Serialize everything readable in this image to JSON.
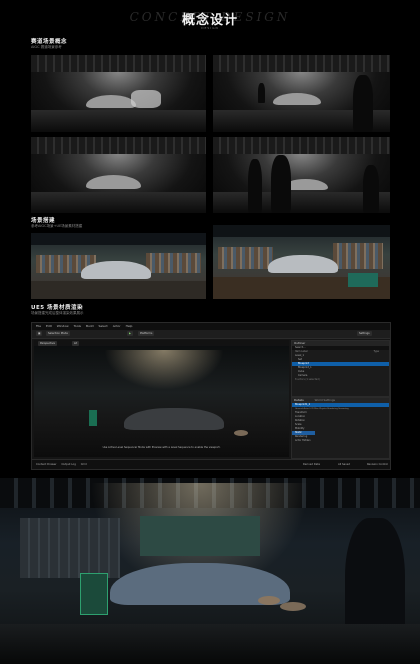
{
  "header": {
    "ghost_text": "CONCEPT DESIGN",
    "title": "概念设计",
    "subtitle": "DESIGN"
  },
  "section1": {
    "heading": "赛道场景概念",
    "caption": "AIGC 赛道场景参考"
  },
  "section2": {
    "heading": "场景搭建",
    "caption": "参考AIGC场景+UE场景素材搭建"
  },
  "section3": {
    "heading": "UE5 场景材质渲染",
    "caption": "场景搭建完成后整体渲染效果展示"
  },
  "editor": {
    "menu": [
      "File",
      "Edit",
      "Window",
      "Tools",
      "Build",
      "Select",
      "Actor",
      "Help"
    ],
    "toolbar": {
      "mode": "Selection Mode",
      "play": "Platforms",
      "settings": "Settings"
    },
    "viewport": {
      "perspective": "Perspective",
      "lit": "Lit",
      "message": "Use Active Level Sequencer Mode with Preview with a Level Sequence to enable the viewport."
    },
    "outliner": {
      "title": "Outliner",
      "search": "Search...",
      "col_label": "Item Label",
      "col_type": "Type",
      "rows": [
        "Level_1",
        "Set",
        "Blueprint",
        "Blueprint_1",
        "Cube",
        "Camera"
      ],
      "selected_index": 2,
      "count": "8 actors (1 selected)"
    },
    "details": {
      "title": "Details",
      "world": "World Settings",
      "object": "Blueprint1_2",
      "tabs": [
        "General",
        "Actor",
        "LOD",
        "Misc",
        "Physics",
        "Rendering",
        "Streaming"
      ],
      "rows": [
        "Transform",
        "Location",
        "Rotation",
        "Scale",
        "Mobility",
        "Static",
        "Rendering",
        "Actor Hidden"
      ]
    },
    "status": {
      "left": "Content Drawer",
      "cmd": "Output Log",
      "cmd2": "Cmd",
      "right1": "Derived Data",
      "right2": "All Saved",
      "right3": "Revision Control"
    }
  }
}
